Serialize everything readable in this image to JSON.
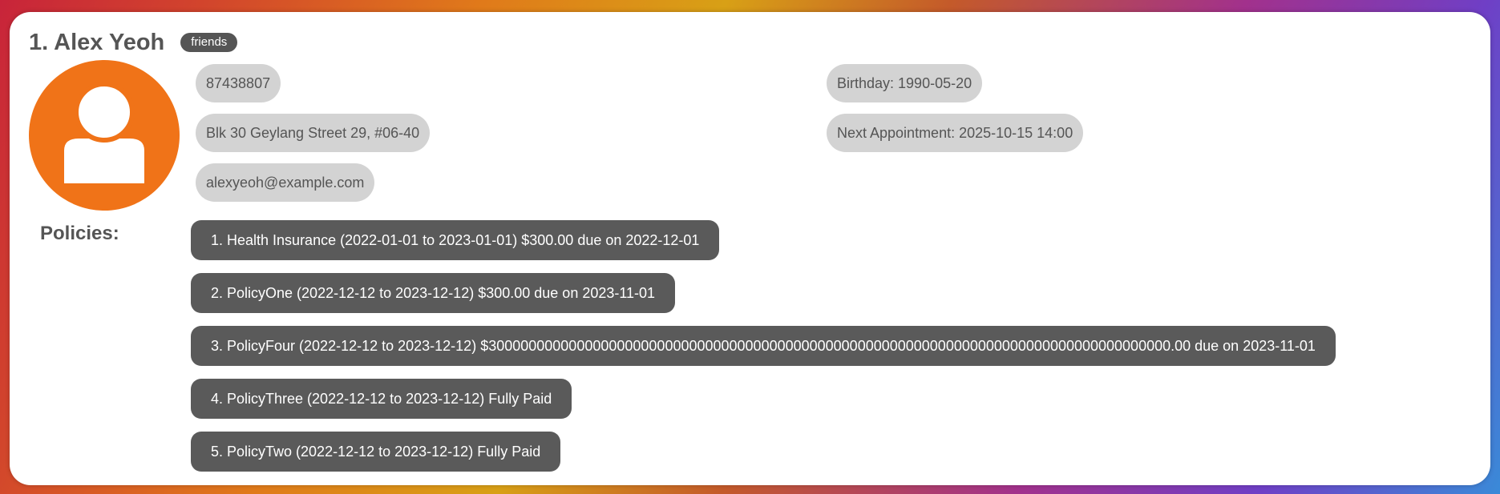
{
  "person": {
    "name": "1. Alex Yeoh",
    "tag": "friends",
    "avatar_icon": "user-icon",
    "avatar_color": "#f07318",
    "phone": "87438807",
    "address": "Blk 30 Geylang Street 29, #06-40",
    "email": "alexyeoh@example.com",
    "birthday": "Birthday: 1990-05-20",
    "next_appointment": "Next Appointment: 2025-10-15 14:00"
  },
  "policies": {
    "label": "Policies:",
    "items": [
      "1. Health Insurance (2022-01-01 to 2023-01-01) $300.00 due on 2022-12-01",
      "2. PolicyOne (2022-12-12 to 2023-12-12) $300.00 due on 2023-11-01",
      "3. PolicyFour (2022-12-12 to 2023-12-12) $3000000000000000000000000000000000000000000000000000000000000000000000000000000000000.00 due on 2023-11-01",
      "4. PolicyThree (2022-12-12 to 2023-12-12) Fully Paid",
      "5. PolicyTwo (2022-12-12 to 2023-12-12) Fully Paid"
    ]
  }
}
